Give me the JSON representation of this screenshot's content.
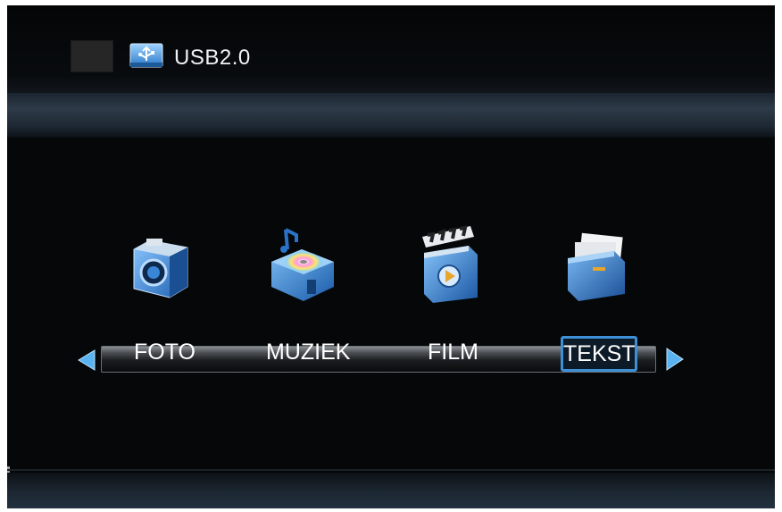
{
  "header": {
    "source_label": "USB2.0",
    "source_icon": "usb-drive-icon"
  },
  "menu": {
    "items": [
      {
        "label": "FOTO",
        "icon": "photo-camera-icon"
      },
      {
        "label": "MUZIEK",
        "icon": "music-box-icon"
      },
      {
        "label": "FILM",
        "icon": "film-clapper-icon"
      },
      {
        "label": "TEKST",
        "icon": "text-folder-icon"
      }
    ],
    "selected_label": "TEKST"
  },
  "colors": {
    "background": "#050709",
    "accent_blue": "#3d8fd6",
    "text": "#ffffff"
  }
}
